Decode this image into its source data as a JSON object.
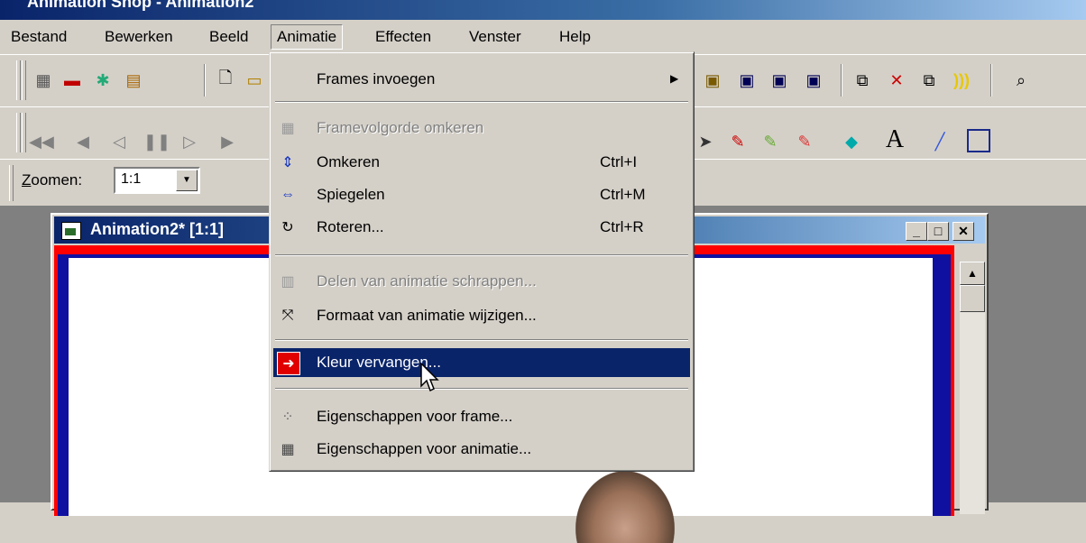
{
  "app_title": "Animation Shop - Animation2",
  "menubar": {
    "items": [
      {
        "label": "Bestand"
      },
      {
        "label": "Bewerken"
      },
      {
        "label": "Beeld"
      },
      {
        "label": "Animatie"
      },
      {
        "label": "Effecten"
      },
      {
        "label": "Venster"
      },
      {
        "label": "Help"
      }
    ]
  },
  "zoom": {
    "label": "Zoomen:",
    "value": "1:1"
  },
  "child_window": {
    "title": "Animation2* [1:1]"
  },
  "animatie_menu": {
    "items": [
      {
        "label": "Frames invoegen",
        "shortcut": "",
        "submenu": true,
        "enabled": true,
        "icon": "none"
      },
      {
        "label": "Framevolgorde omkeren",
        "shortcut": "",
        "enabled": false,
        "icon": "film-reverse-icon"
      },
      {
        "label": "Omkeren",
        "shortcut": "Ctrl+I",
        "enabled": true,
        "icon": "flip-vertical-icon"
      },
      {
        "label": "Spiegelen",
        "shortcut": "Ctrl+M",
        "enabled": true,
        "icon": "mirror-icon"
      },
      {
        "label": "Roteren...",
        "shortcut": "Ctrl+R",
        "enabled": true,
        "icon": "rotate-icon"
      },
      {
        "label": "Delen van animatie schrappen...",
        "shortcut": "",
        "enabled": false,
        "icon": "crop-icon"
      },
      {
        "label": "Formaat van animatie wijzigen...",
        "shortcut": "",
        "enabled": true,
        "icon": "resize-icon"
      },
      {
        "label": "Kleur vervangen...",
        "shortcut": "",
        "enabled": true,
        "highlighted": true,
        "icon": "replace-color-icon"
      },
      {
        "label": "Eigenschappen voor frame...",
        "shortcut": "",
        "enabled": true,
        "icon": "frame-properties-icon"
      },
      {
        "label": "Eigenschappen voor animatie...",
        "shortcut": "",
        "enabled": true,
        "icon": "animation-properties-icon"
      }
    ]
  },
  "colors": {
    "menu_bg": "#d4d0c8",
    "highlight": "#0a246a",
    "titlebar": "#0a246a",
    "canvas_border_red": "#ff0000",
    "canvas_border_blue": "#1010a0"
  }
}
